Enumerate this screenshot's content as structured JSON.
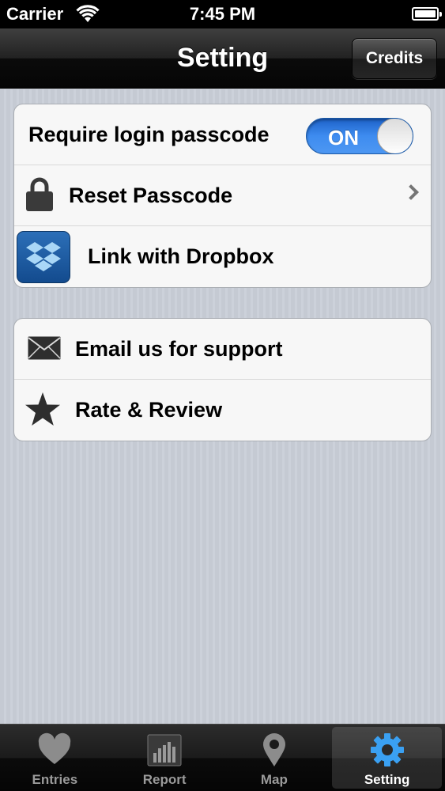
{
  "status_bar": {
    "carrier": "Carrier",
    "time": "7:45 PM"
  },
  "nav_bar": {
    "title": "Setting",
    "credits_label": "Credits"
  },
  "groups": [
    {
      "rows": [
        {
          "label": "Require login passcode",
          "toggle": {
            "state": "ON",
            "on": true
          }
        },
        {
          "label": "Reset Passcode",
          "icon": "lock-icon",
          "disclosure": "chevron-right-icon"
        },
        {
          "label": "Link with Dropbox",
          "icon": "dropbox-icon"
        }
      ]
    },
    {
      "rows": [
        {
          "label": "Email us for support",
          "icon": "envelope-icon"
        },
        {
          "label": "Rate & Review",
          "icon": "star-icon"
        }
      ]
    }
  ],
  "tab_bar": {
    "tabs": [
      {
        "label": "Entries",
        "icon": "heart-icon",
        "selected": false
      },
      {
        "label": "Report",
        "icon": "bar-chart-icon",
        "selected": false
      },
      {
        "label": "Map",
        "icon": "map-pin-icon",
        "selected": false
      },
      {
        "label": "Setting",
        "icon": "gear-icon",
        "selected": true
      }
    ]
  },
  "colors": {
    "accent": "#3e8cf0",
    "background": "#c9ced7",
    "cell": "#f7f7f7"
  }
}
